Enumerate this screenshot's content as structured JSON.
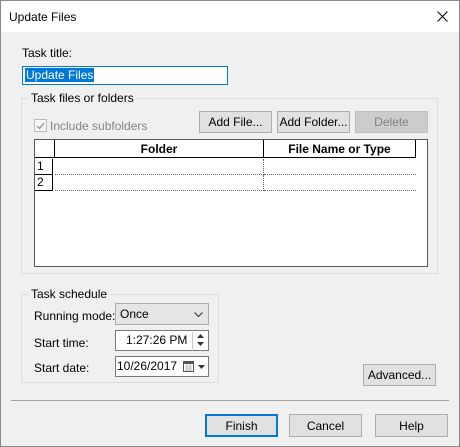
{
  "window": {
    "title": "Update Files"
  },
  "task_title": {
    "label": "Task title:",
    "value": "Update Files"
  },
  "files_group": {
    "title": "Task files or folders",
    "include_subfolders_label": "Include subfolders",
    "include_subfolders_checked": true,
    "add_file_label": "Add File...",
    "add_folder_label": "Add Folder...",
    "delete_label": "Delete",
    "columns": [
      "Folder",
      "File Name or Type"
    ],
    "rows": [
      {
        "num": "1",
        "folder": "",
        "file": ""
      },
      {
        "num": "2",
        "folder": "",
        "file": ""
      }
    ]
  },
  "schedule_group": {
    "title": "Task schedule",
    "running_mode_label": "Running mode:",
    "running_mode_value": "Once",
    "start_time_label": "Start time:",
    "start_time_value": "1:27:26 PM",
    "start_date_label": "Start date:",
    "start_date_value": "10/26/2017"
  },
  "buttons": {
    "advanced": "Advanced...",
    "finish": "Finish",
    "cancel": "Cancel",
    "help": "Help"
  },
  "icons": [
    "close-icon",
    "checkmark-icon",
    "chevron-down-icon",
    "spin-up-icon",
    "spin-down-icon",
    "calendar-icon"
  ],
  "colors": {
    "accent": "#0078d7",
    "dialog_bg": "#f0f0f0",
    "button_bg": "#e1e1e1"
  }
}
